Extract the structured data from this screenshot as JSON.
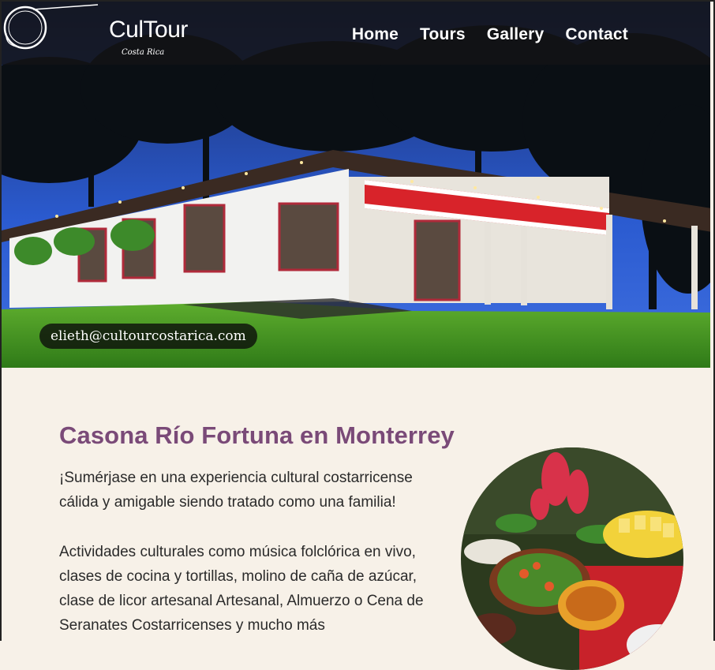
{
  "brand": {
    "name": "CulTour",
    "tagline": "Costa Rica"
  },
  "nav": {
    "items": [
      "Home",
      "Tours",
      "Gallery",
      "Contact"
    ]
  },
  "hero": {
    "email": "elieth@cultourcostarica.com"
  },
  "main": {
    "title": "Casona Río Fortuna en Monterrey",
    "paragraph1": "¡Sumérjase en una experiencia cultural costarricense cálida y amigable siendo tratado como una familia!",
    "paragraph2": "Actividades culturales como música folclórica en vivo, clases de cocina y tortillas, molino de caña de azúcar, clase de licor artesanal Artesanal, Almuerzo o Cena de Seranates Costarricenses y mucho más"
  },
  "colors": {
    "accent": "#7a4a78",
    "background": "#f7f1e8",
    "navbar": "#141416"
  }
}
